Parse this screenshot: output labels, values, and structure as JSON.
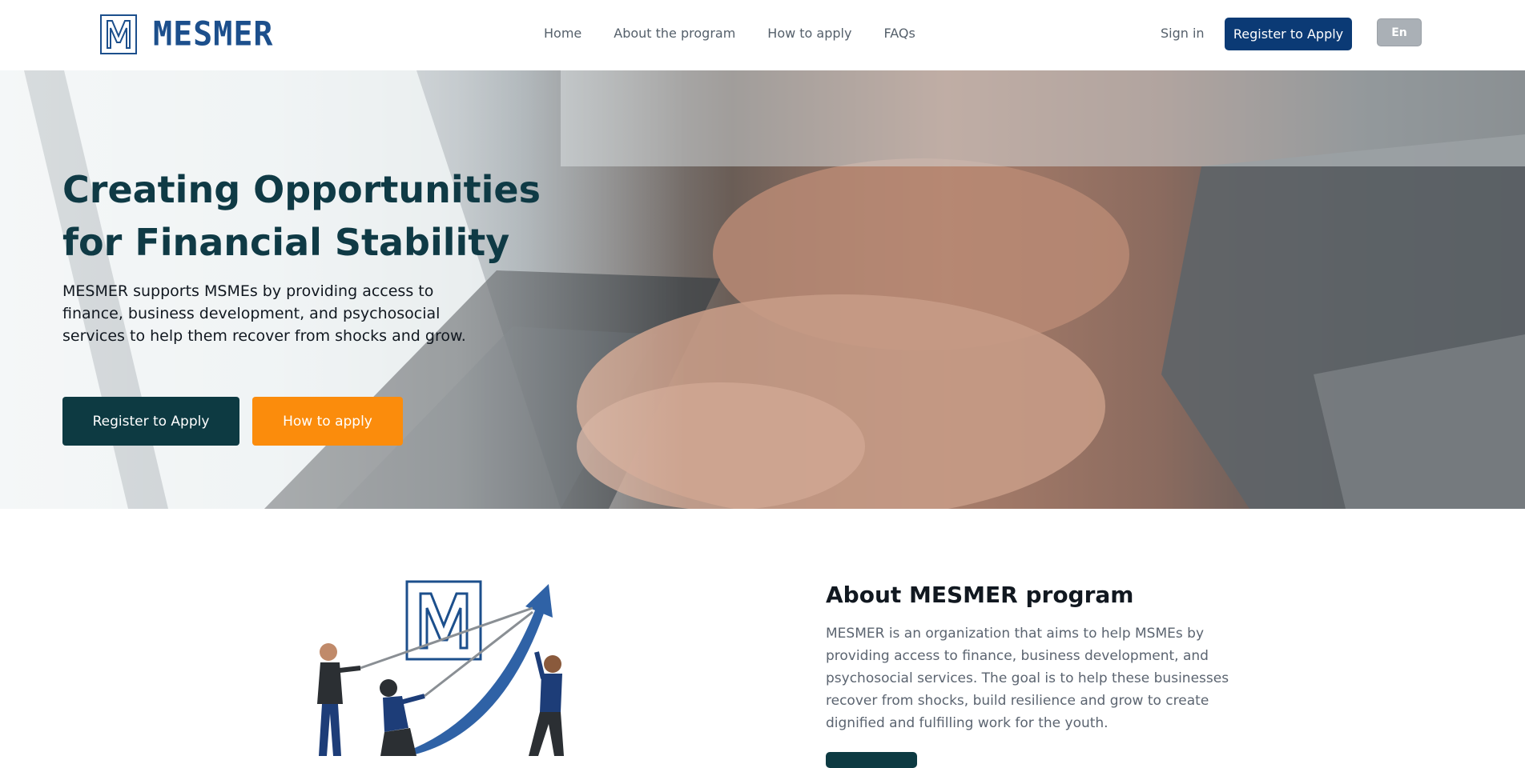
{
  "header": {
    "brand": "MESMER",
    "logo_letter": "M",
    "nav": [
      {
        "label": "Home"
      },
      {
        "label": "About the program"
      },
      {
        "label": "How to apply"
      },
      {
        "label": "FAQs"
      }
    ],
    "signin_label": "Sign in",
    "register_label": "Register to Apply",
    "language_label": "En"
  },
  "hero": {
    "title": "Creating Opportunities for Financial Stability",
    "subtitle": "MESMER supports MSMEs by providing access to finance, business development, and psychosocial services to help them recover from shocks and grow.",
    "primary_button": "Register to Apply",
    "secondary_button": "How to apply"
  },
  "about": {
    "title": "About MESMER program",
    "text": "MESMER is an organization that aims to help MSMEs by providing access to finance, business development, and psychosocial services. The goal is to help these businesses recover from shocks, build resilience and grow to create dignified and fulfilling work for the youth.",
    "illustration_letter": "M"
  },
  "colors": {
    "brand_blue": "#0b3a75",
    "hero_title": "#0f3a45",
    "dark_button": "#0d3a42",
    "orange_button": "#fb8c0c",
    "language_button": "#aab0b6"
  }
}
